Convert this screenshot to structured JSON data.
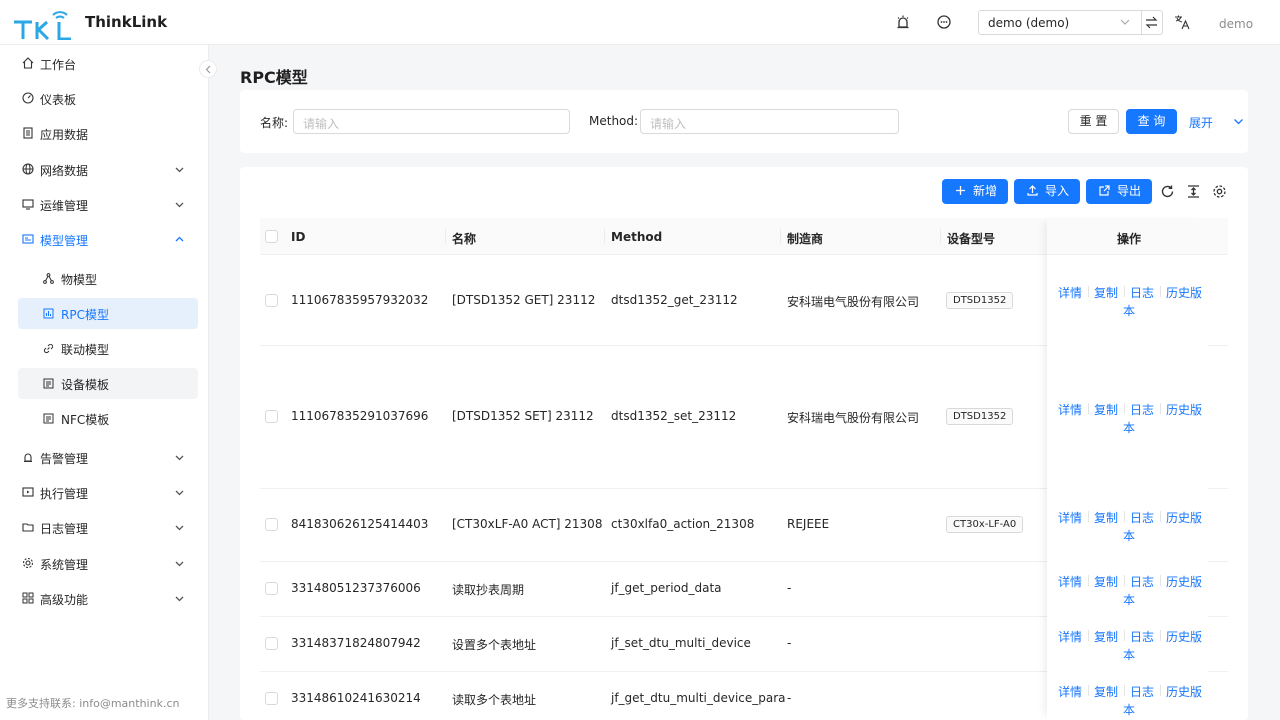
{
  "brand": {
    "name": "ThinkLink"
  },
  "header": {
    "tenant": "demo (demo)",
    "user": "demo"
  },
  "sidebar": {
    "items": [
      {
        "label": "工作台"
      },
      {
        "label": "仪表板"
      },
      {
        "label": "应用数据"
      },
      {
        "label": "网络数据"
      },
      {
        "label": "运维管理"
      },
      {
        "label": "模型管理"
      },
      {
        "label": "告警管理"
      },
      {
        "label": "执行管理"
      },
      {
        "label": "日志管理"
      },
      {
        "label": "系统管理"
      },
      {
        "label": "高级功能"
      }
    ],
    "subitems": [
      {
        "label": "物模型"
      },
      {
        "label": "RPC模型"
      },
      {
        "label": "联动模型"
      },
      {
        "label": "设备模板"
      },
      {
        "label": "NFC模板"
      }
    ],
    "support": "更多支持联系: info@manthink.cn"
  },
  "page": {
    "title": "RPC模型"
  },
  "search": {
    "name_label": "名称",
    "name_placeholder": "请输入",
    "method_label": "Method",
    "method_placeholder": "请输入",
    "reset": "重 置",
    "query": "查 询",
    "expand": "展开"
  },
  "toolbar": {
    "add": "新增",
    "import": "导入",
    "export": "导出"
  },
  "table": {
    "columns": {
      "id": "ID",
      "name": "名称",
      "method": "Method",
      "maker": "制造商",
      "model": "设备型号",
      "ops": "操作"
    },
    "ops": {
      "detail": "详情",
      "copy": "复制",
      "log": "日志",
      "history1": "历史版",
      "history2": "本"
    },
    "rows": [
      {
        "id": "111067835957932032",
        "name": "[DTSD1352 GET] 23112",
        "method": "dtsd1352_get_23112",
        "maker": "安科瑞电气股份有限公司",
        "model": "DTSD1352"
      },
      {
        "id": "111067835291037696",
        "name": "[DTSD1352 SET] 23112",
        "method": "dtsd1352_set_23112",
        "maker": "安科瑞电气股份有限公司",
        "model": "DTSD1352"
      },
      {
        "id": "841830626125414403",
        "name": "[CT30xLF-A0 ACT] 21308",
        "method": "ct30xlfa0_action_21308",
        "maker": "REJEEE",
        "model": "CT30x-LF-A0"
      },
      {
        "id": "33148051237376006",
        "name": "读取抄表周期",
        "method": "jf_get_period_data",
        "maker": "-",
        "model": ""
      },
      {
        "id": "33148371824807942",
        "name": "设置多个表地址",
        "method": "jf_set_dtu_multi_device",
        "maker": "-",
        "model": ""
      },
      {
        "id": "33148610241630214",
        "name": "读取多个表地址",
        "method": "jf_get_dtu_multi_device_para",
        "maker": "-",
        "model": ""
      }
    ]
  }
}
